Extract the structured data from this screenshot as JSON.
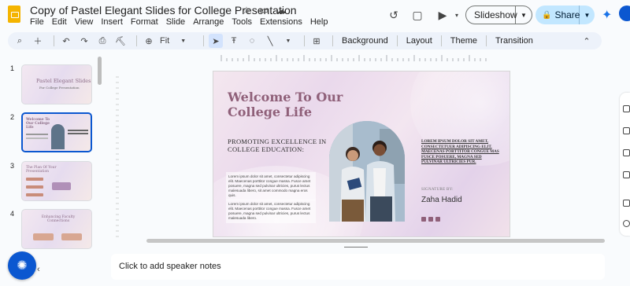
{
  "app": {
    "doc_title": "Copy of Pastel Elegant Slides for College Presentation",
    "menu": [
      "File",
      "Edit",
      "View",
      "Insert",
      "Format",
      "Slide",
      "Arrange",
      "Tools",
      "Extensions",
      "Help"
    ]
  },
  "header": {
    "slideshow_label": "Slideshow",
    "share_label": "Share"
  },
  "toolbar": {
    "zoom": "Fit",
    "background": "Background",
    "layout": "Layout",
    "theme": "Theme",
    "transition": "Transition"
  },
  "filmstrip": {
    "slides": [
      {
        "num": "1",
        "title": "Pastel Elegant Slides",
        "subtitle": "For College Presentation"
      },
      {
        "num": "2",
        "title": "Welcome To Our College Life",
        "selected": true
      },
      {
        "num": "3",
        "title": "The Plan Of Your Presentation"
      },
      {
        "num": "4",
        "title": "Enhancing Faculty Connections"
      }
    ]
  },
  "slide": {
    "title": "Welcome To Our College Life",
    "subtitle": "PROMOTING EXCELLENCE IN COLLEGE EDUCATION:",
    "para1": "Lorem ipsum dolor sit amet, consectetur adipiscing elit. Maecenas porttitor congue massa. Fusce amet posuere, magna sed pulvinar ultricies, purus lectus malesuada libero, sit amet commodo magna eros quis.",
    "para2": "Lorem ipsum dolor sit amet, consectetur adipiscing elit. Maecenas porttitor congue massa. Fusce amet posuere, magna sed pulvinar ultricies, purus lectus malesuada libero.",
    "right_text": "LOREM IPSUM DOLOR SIT AMET, CONSECTETUER ADIPISCING ELIT. MAECENAS PORTTITOR CONGUE MAS FUSCE POSUERE, MAGNA SED PULVINAR ULTRICIES PUR.",
    "signature_label": "SIGNATURE BY:",
    "signature_name": "Zaha Hadid"
  },
  "notes": {
    "placeholder": "Click to add speaker notes"
  },
  "colors": {
    "accent": "#0b57d0",
    "share_bg": "#c2e7ff",
    "slide_title": "#8f6079"
  }
}
